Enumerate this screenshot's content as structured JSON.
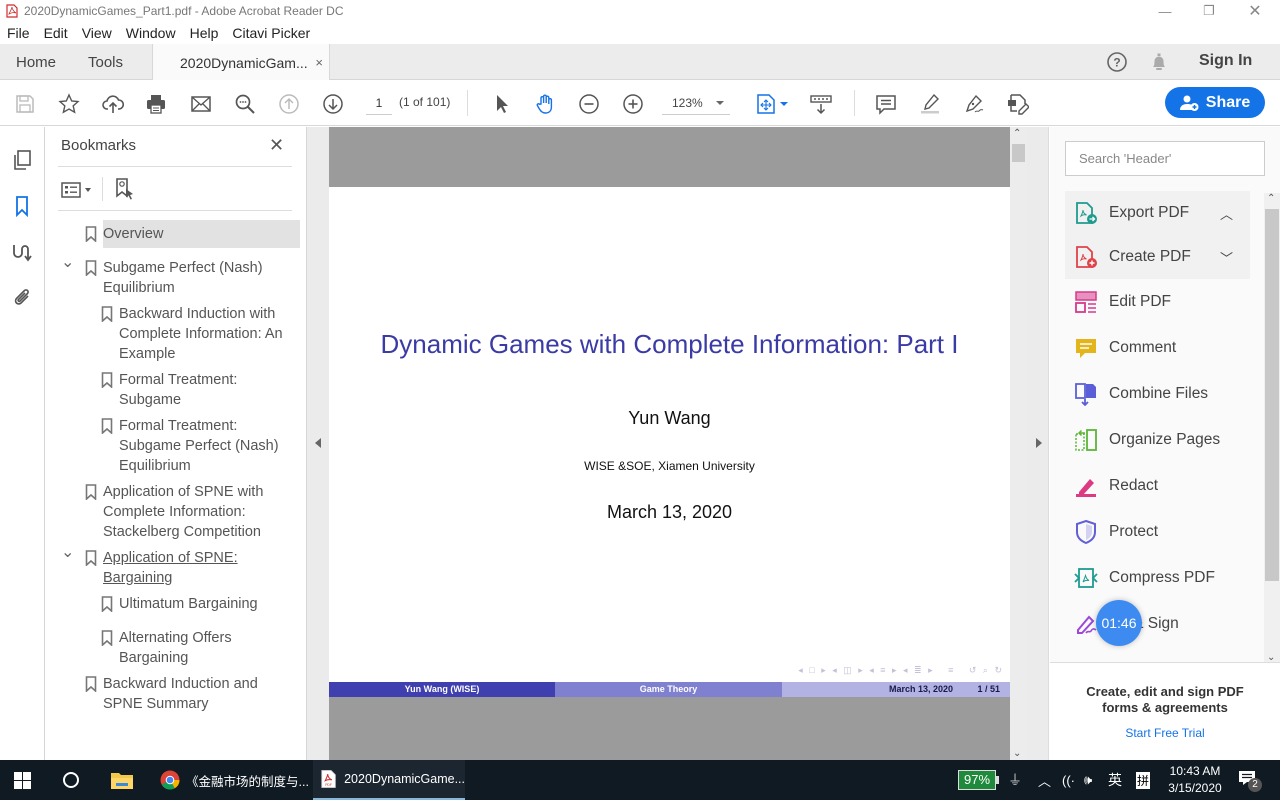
{
  "window": {
    "title": "2020DynamicGames_Part1.pdf - Adobe Acrobat Reader DC",
    "controls": [
      "minimize",
      "restore",
      "close"
    ]
  },
  "menu": [
    "File",
    "Edit",
    "View",
    "Window",
    "Help",
    "Citavi Picker"
  ],
  "tabs": {
    "home": "Home",
    "tools": "Tools",
    "document": "2020DynamicGam...",
    "close_glyph": "×"
  },
  "topright": {
    "help_icon": "help-circle-icon",
    "bell_icon": "bell-icon",
    "sign_in": "Sign In"
  },
  "toolbar": {
    "page_number": "1",
    "page_count": "(1 of 101)",
    "zoom": "123%",
    "share_label": "Share",
    "icons": [
      "save-icon",
      "star-icon",
      "upload-icon",
      "print-icon",
      "email-icon",
      "find-icon",
      "page-up-icon",
      "page-down-icon",
      "select-icon",
      "hand-icon",
      "zoom-out-icon",
      "zoom-in-icon",
      "fit-page-icon",
      "scroll-mode-icon",
      "comment-icon",
      "highlight-icon",
      "sign-icon",
      "edit-icon"
    ]
  },
  "bookmarks": {
    "title": "Bookmarks",
    "items": [
      {
        "label": "Overview",
        "level": 0,
        "selected": true
      },
      {
        "label": "Subgame Perfect (Nash) Equilibrium",
        "level": 0,
        "expanded": true
      },
      {
        "label": "Backward Induction with Complete Information: An Example",
        "level": 1
      },
      {
        "label": "Formal Treatment: Subgame",
        "level": 1
      },
      {
        "label": "Formal Treatment: Subgame Perfect (Nash) Equilibrium",
        "level": 1
      },
      {
        "label": "Application of SPNE with Complete Information: Stackelberg Competition",
        "level": 0
      },
      {
        "label": "Application of SPNE: Bargaining",
        "level": 0,
        "expanded": true,
        "hovered": true
      },
      {
        "label": "Ultimatum Bargaining",
        "level": 1
      },
      {
        "label": "Alternating Offers Bargaining",
        "level": 1
      },
      {
        "label": "Backward Induction and SPNE Summary",
        "level": 0
      }
    ]
  },
  "document": {
    "title": "Dynamic Games with Complete Information: Part I",
    "author": "Yun Wang",
    "institution": "WISE &SOE, Xiamen University",
    "date": "March 13, 2020",
    "footer": {
      "left": "Yun Wang (WISE)",
      "center": "Game Theory",
      "date": "March 13, 2020",
      "page": "1 / 51"
    },
    "colors": {
      "title": "#3b3ba6",
      "footer_dark": "#3f3fb0",
      "footer_mid": "#8080d0",
      "footer_light": "#b3b3e3"
    }
  },
  "tools_panel": {
    "search_placeholder": "Search 'Header'",
    "items": [
      {
        "label": "Export PDF",
        "chevron": "up",
        "color": "#1f9c8f"
      },
      {
        "label": "Create PDF",
        "chevron": "down",
        "color": "#e0424a"
      },
      {
        "label": "Edit PDF",
        "color": "#d63a8c"
      },
      {
        "label": "Comment",
        "color": "#e3b51b"
      },
      {
        "label": "Combine Files",
        "color": "#5a5fd8"
      },
      {
        "label": "Organize Pages",
        "color": "#5db639"
      },
      {
        "label": "Redact",
        "color": "#dc3b83"
      },
      {
        "label": "Protect",
        "color": "#6160d6"
      },
      {
        "label": "Compress PDF",
        "color": "#1f9c8f"
      },
      {
        "label": "Fill & Sign",
        "color": "#9c48d8"
      }
    ],
    "promo_text": "Create, edit and sign PDF forms & agreements",
    "promo_link": "Start Free Trial"
  },
  "overlay_timer": "01:46",
  "taskbar": {
    "apps": [
      {
        "label": "《金融市场的制度与...",
        "icon": "chrome-icon"
      },
      {
        "label": "2020DynamicGame...",
        "icon": "acrobat-icon",
        "active": true
      }
    ],
    "battery": "97%",
    "ime_lang": "英",
    "ime_mode": "拼",
    "time": "10:43 AM",
    "date": "3/15/2020",
    "notifications": "2"
  }
}
